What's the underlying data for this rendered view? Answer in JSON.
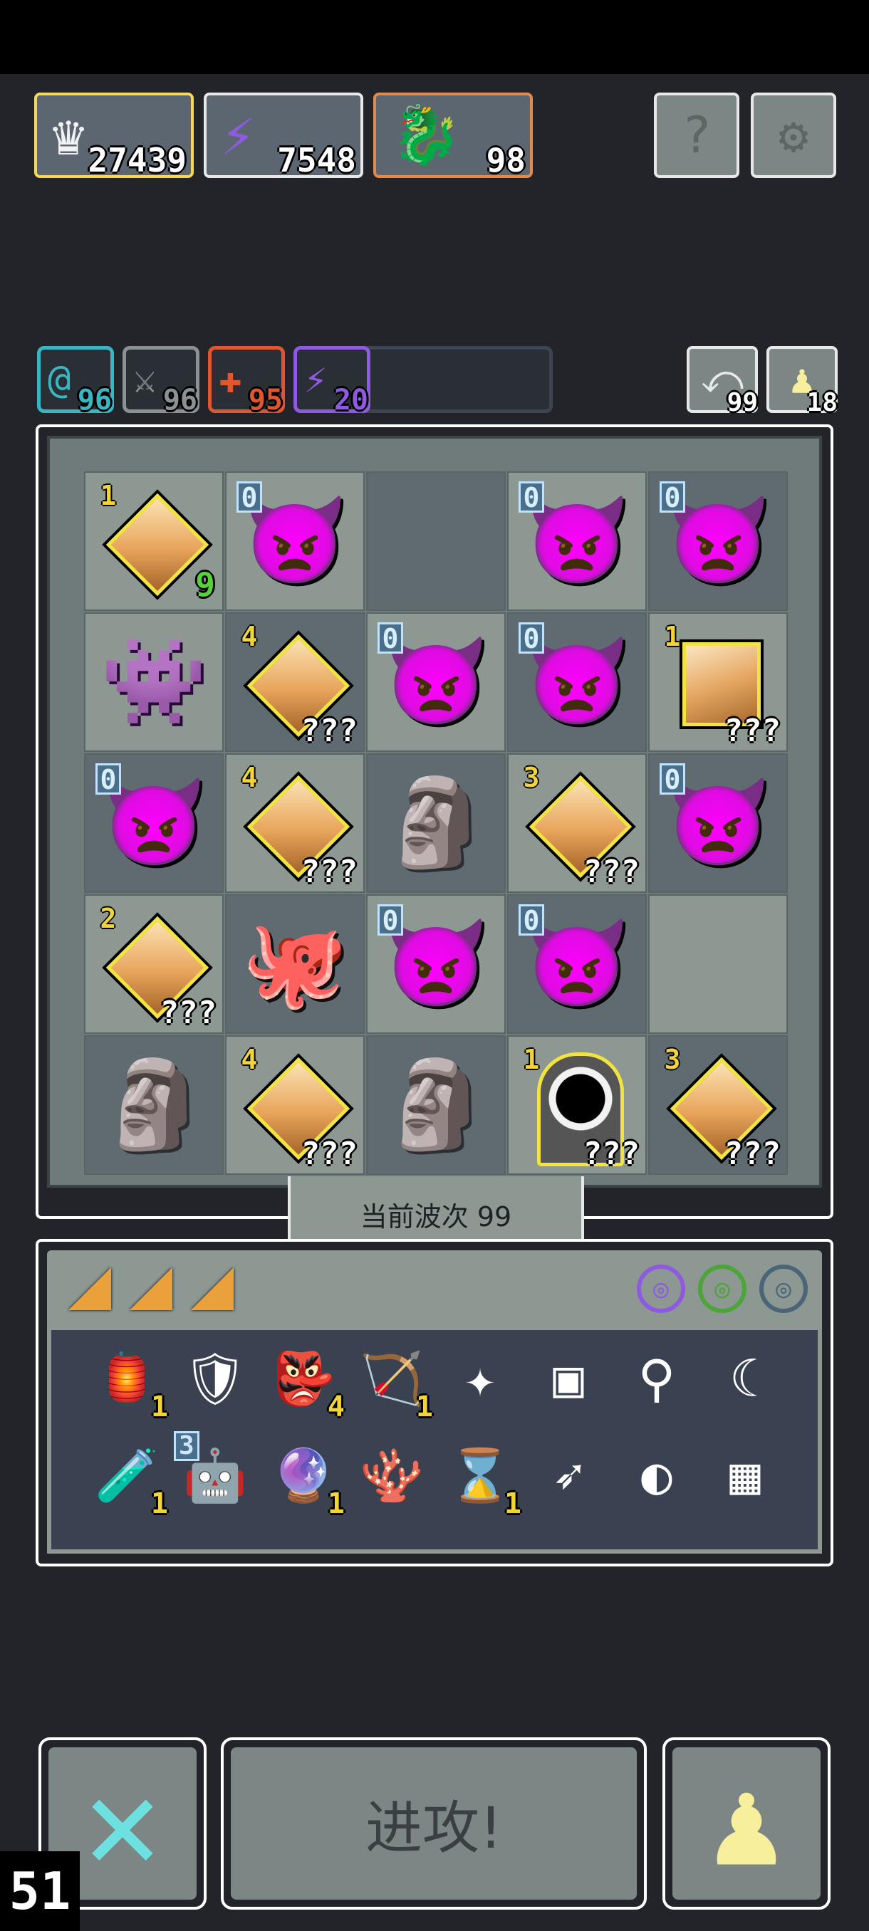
{
  "resources": [
    {
      "icon": "crown-icon",
      "glyph": "♛",
      "value": "27439",
      "border": "#f5d75a"
    },
    {
      "icon": "energy-icon",
      "glyph": "⚡",
      "value": "7548",
      "border": "#e8e8e8"
    },
    {
      "icon": "dragon-portrait-icon",
      "glyph": "🐉",
      "value": "98",
      "border": "#e3894a"
    }
  ],
  "top_buttons": [
    {
      "icon": "help-icon",
      "glyph": "?"
    },
    {
      "icon": "settings-gear-icon",
      "glyph": "⚙"
    }
  ],
  "status_chips": [
    {
      "icon": "at-icon",
      "glyph": "@",
      "value": "96",
      "color": "#39b6c2"
    },
    {
      "icon": "crossed-swords-icon",
      "glyph": "⚔",
      "value": "96",
      "color": "#8a9294"
    },
    {
      "icon": "plus-icon",
      "glyph": "✚",
      "value": "95",
      "color": "#e0572f"
    },
    {
      "icon": "energy-icon",
      "glyph": "⚡",
      "value": "20",
      "color": "#8e5ae0"
    }
  ],
  "right_chips": [
    {
      "icon": "return-arrow-icon",
      "glyph": "⤺",
      "value": "99"
    },
    {
      "icon": "pawn-icon",
      "glyph": "♟",
      "value": "18"
    }
  ],
  "board": [
    [
      {
        "type": "gem",
        "level": "1",
        "count": "9",
        "bg": "light"
      },
      {
        "type": "dragon",
        "level": "0",
        "bg": "light"
      },
      {
        "type": "empty",
        "bg": "dark"
      },
      {
        "type": "dragon",
        "level": "0",
        "bg": "light"
      },
      {
        "type": "dragon",
        "level": "0",
        "bg": "dark"
      }
    ],
    [
      {
        "type": "purple",
        "bg": "light"
      },
      {
        "type": "gem",
        "level": "4",
        "qqq": "???",
        "bg": "dark"
      },
      {
        "type": "dragon",
        "level": "0",
        "bg": "light"
      },
      {
        "type": "dragon",
        "level": "0",
        "bg": "dark"
      },
      {
        "type": "cube",
        "level": "1",
        "qqq": "???",
        "bg": "light"
      }
    ],
    [
      {
        "type": "dragon",
        "level": "0",
        "bg": "dark"
      },
      {
        "type": "gem",
        "level": "4",
        "qqq": "???",
        "bg": "light"
      },
      {
        "type": "golem",
        "bg": "dark"
      },
      {
        "type": "gem",
        "level": "3",
        "qqq": "???",
        "bg": "light"
      },
      {
        "type": "dragon",
        "level": "0",
        "bg": "dark"
      }
    ],
    [
      {
        "type": "gem",
        "level": "2",
        "qqq": "???",
        "bg": "light"
      },
      {
        "type": "dark",
        "bg": "dark"
      },
      {
        "type": "dragon",
        "level": "0",
        "bg": "light"
      },
      {
        "type": "dragon",
        "level": "0",
        "bg": "dark"
      },
      {
        "type": "empty",
        "bg": "light"
      }
    ],
    [
      {
        "type": "golem",
        "bg": "dark"
      },
      {
        "type": "gem",
        "level": "4",
        "qqq": "???",
        "bg": "light"
      },
      {
        "type": "golem",
        "bg": "dark"
      },
      {
        "type": "portal",
        "level": "1",
        "qqq": "???",
        "bg": "light"
      },
      {
        "type": "gem",
        "level": "3",
        "qqq": "???",
        "bg": "dark"
      }
    ]
  ],
  "wave_label": "当前波次 99",
  "inventory": {
    "mini_icons": [
      {
        "icon": "purple-ring-icon",
        "glyph": "◎",
        "color": "#8e5ae0"
      },
      {
        "icon": "green-ring-icon",
        "glyph": "◎",
        "color": "#4ca43a"
      },
      {
        "icon": "dark-ring-icon",
        "glyph": "◎",
        "color": "#4a6478"
      }
    ],
    "items_row1": [
      {
        "icon": "lantern-icon",
        "glyph": "🏮",
        "count": "1"
      },
      {
        "icon": "armor-icon",
        "glyph": "🛡",
        "count": ""
      },
      {
        "icon": "goblin-icon",
        "glyph": "👺",
        "count": "4"
      },
      {
        "icon": "crossbow-icon",
        "glyph": "🏹",
        "count": "1"
      },
      {
        "icon": "shuriken-icon",
        "glyph": "✦",
        "count": ""
      },
      {
        "icon": "magic-carpet-icon",
        "glyph": "▣",
        "count": ""
      },
      {
        "icon": "lever-icon",
        "glyph": "⚲",
        "count": ""
      },
      {
        "icon": "sickle-icon",
        "glyph": "☾",
        "count": ""
      }
    ],
    "items_row2": [
      {
        "icon": "potion-jar-icon",
        "glyph": "🧪",
        "count": "1",
        "top": ""
      },
      {
        "icon": "robot-icon",
        "glyph": "🤖",
        "count": "",
        "top": "3"
      },
      {
        "icon": "crystal-ball-icon",
        "glyph": "🔮",
        "count": "1",
        "top": ""
      },
      {
        "icon": "coral-icon",
        "glyph": "🪸",
        "count": "",
        "top": ""
      },
      {
        "icon": "hourglass-icon",
        "glyph": "⌛",
        "count": "1",
        "top": ""
      },
      {
        "icon": "arrow-icon",
        "glyph": "➶",
        "count": "",
        "top": ""
      },
      {
        "icon": "moon-stone-icon",
        "glyph": "◐",
        "count": "",
        "top": ""
      },
      {
        "icon": "map-icon",
        "glyph": "▦",
        "count": "",
        "top": ""
      }
    ]
  },
  "buttons": {
    "cancel_glyph": "✕",
    "attack_label": "进攻!",
    "pawn_glyph": "♟"
  },
  "counter": "51"
}
